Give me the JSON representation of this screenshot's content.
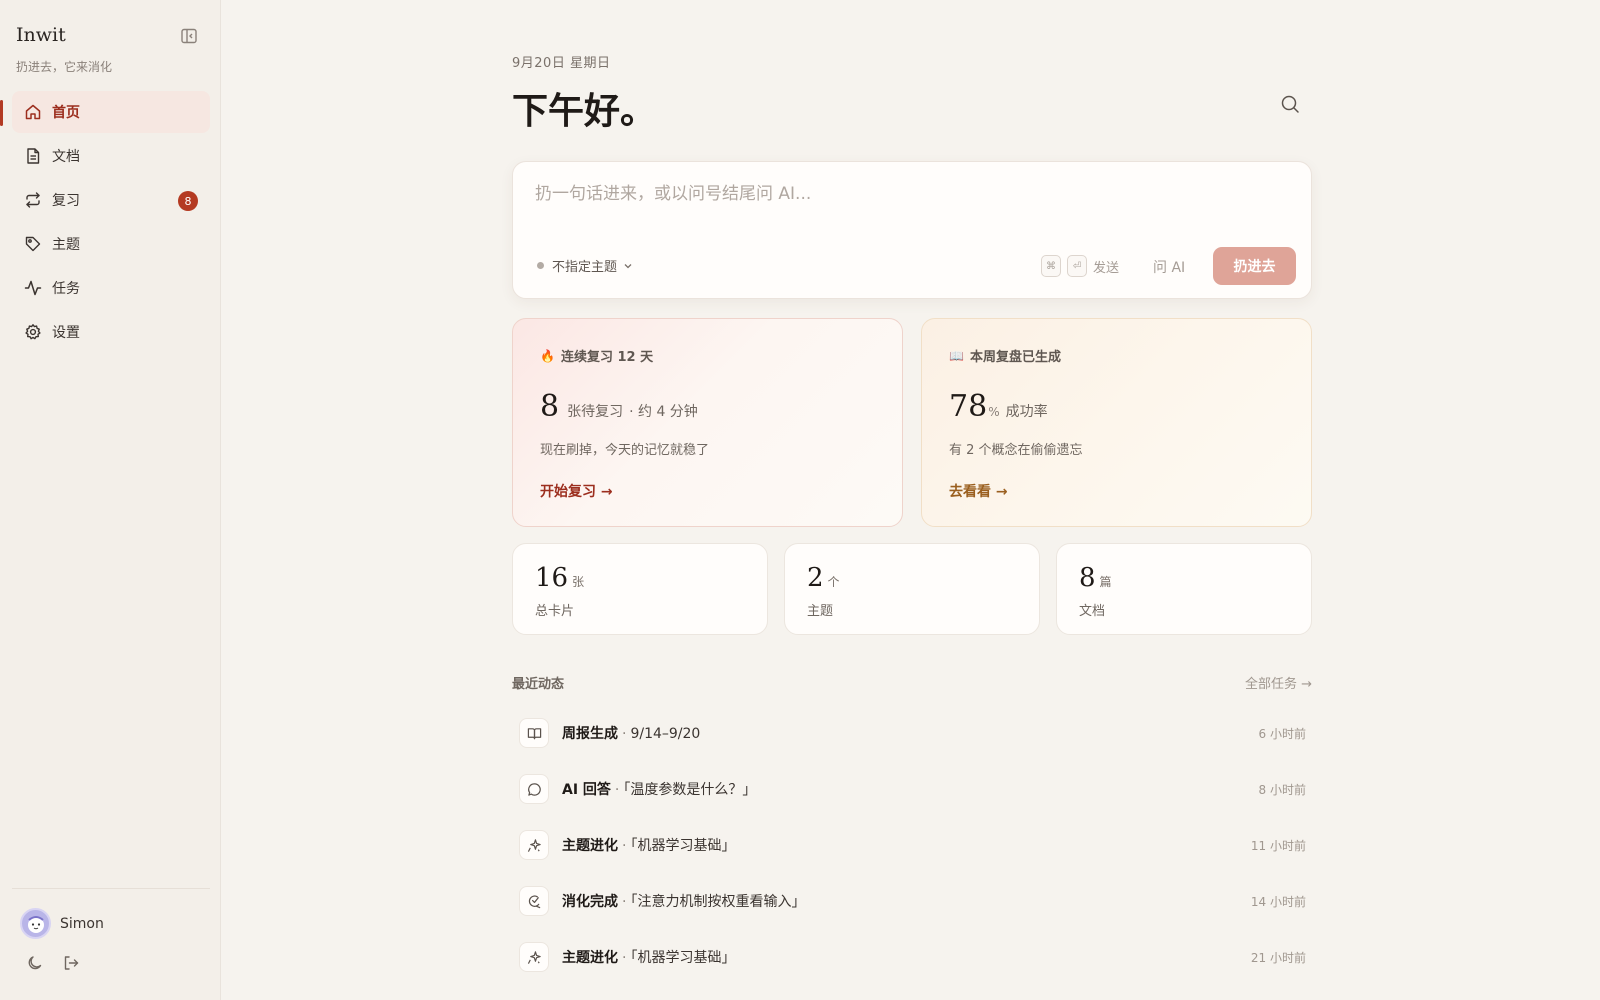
{
  "sidebar": {
    "brand": "Inwit",
    "tagline": "扔进去，它来消化",
    "items": [
      {
        "label": "首页",
        "active": true
      },
      {
        "label": "文档"
      },
      {
        "label": "复习",
        "badge": "8"
      },
      {
        "label": "主题"
      },
      {
        "label": "任务"
      },
      {
        "label": "设置"
      }
    ],
    "user": {
      "name": "Simon"
    }
  },
  "header": {
    "date": "9月20日 星期日",
    "greeting": "下午好。"
  },
  "composer": {
    "placeholder": "扔一句话进来，或以问号结尾问 AI...",
    "topic": "不指定主题",
    "kbd_cmd": "⌘",
    "kbd_enter": "⏎",
    "send_label": "发送",
    "ask_ai": "问 AI",
    "submit": "扔进去"
  },
  "cards": {
    "review": {
      "emoji": "🔥",
      "label": "连续复习 12 天",
      "num": "8",
      "unit": "张待复习",
      "sub": "· 约 4 分钟",
      "desc": "现在刷掉，今天的记忆就稳了",
      "link": "开始复习 →"
    },
    "weekly": {
      "emoji": "📖",
      "label": "本周复盘已生成",
      "num": "78",
      "pct": "%",
      "unit": "成功率",
      "desc": "有 2 个概念在偷偷遗忘",
      "link": "去看看 →"
    }
  },
  "stats": [
    {
      "num": "16",
      "unit": "张",
      "label": "总卡片"
    },
    {
      "num": "2",
      "unit": "个",
      "label": "主题"
    },
    {
      "num": "8",
      "unit": "篇",
      "label": "文档"
    }
  ],
  "activity": {
    "title": "最近动态",
    "all_link": "全部任务 →",
    "items": [
      {
        "kind": "周报生成",
        "detail": "9/14–9/20",
        "time": "6 小时前",
        "icon": "book-icon"
      },
      {
        "kind": "AI 回答",
        "detail": "「温度参数是什么？」",
        "time": "8 小时前",
        "icon": "chat-bubble-icon"
      },
      {
        "kind": "主题进化",
        "detail": "「机器学习基础」",
        "time": "11 小时前",
        "icon": "sparkle-icon"
      },
      {
        "kind": "消化完成",
        "detail": "「注意力机制按权重看输入」",
        "time": "14 小时前",
        "icon": "digest-icon"
      },
      {
        "kind": "主题进化",
        "detail": "「机器学习基础」",
        "time": "21 小时前",
        "icon": "sparkle-icon"
      }
    ]
  },
  "colors": {
    "accent": "#b23a23",
    "submit": "#dfa498",
    "background": "#f6f3ee"
  }
}
